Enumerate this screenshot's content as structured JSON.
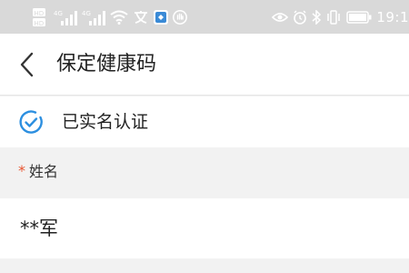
{
  "status_bar": {
    "time": "19:1",
    "left_icons": [
      "hd-icon",
      "signal-4g-icon",
      "signal-4g-icon",
      "wifi-icon",
      "translate-icon",
      "app-notification-icon",
      "hand-icon"
    ],
    "right_icons": [
      "eye-icon",
      "alarm-icon",
      "bluetooth-icon",
      "vibrate-icon",
      "battery-icon"
    ]
  },
  "header": {
    "title": "保定健康码",
    "back_icon": "chevron-left-icon"
  },
  "verification": {
    "text": "已实名认证",
    "icon": "check-circle-icon",
    "accent_color": "#2c8fe0"
  },
  "name_field": {
    "required_mark": "*",
    "label": "姓名",
    "value": "**军",
    "required_color": "#e8542f"
  }
}
